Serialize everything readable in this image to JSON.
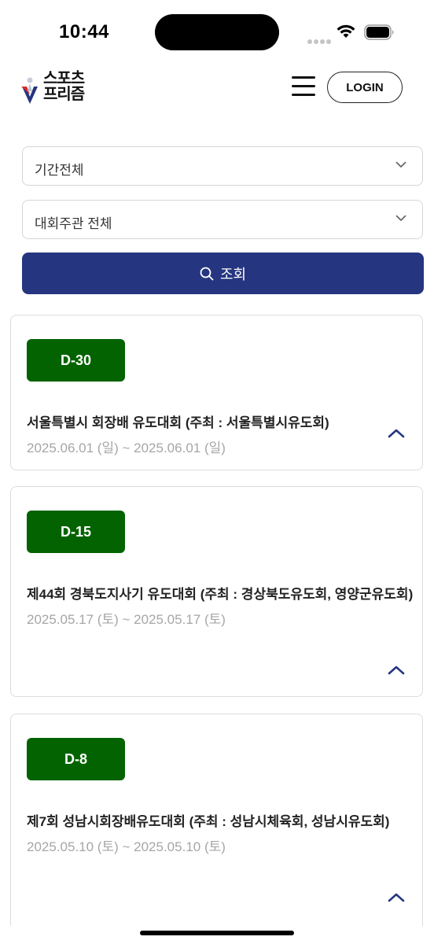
{
  "status": {
    "time": "10:44"
  },
  "header": {
    "logo_line1": "스포츠",
    "logo_line2": "프리즘",
    "login_label": "LOGIN"
  },
  "filters": {
    "period": "기간전체",
    "host": "대회주관 전체",
    "search_label": "조회"
  },
  "events": [
    {
      "dday": "D-30",
      "title": "서울특별시 회장배 유도대회 (주최 : 서울특별시유도회)",
      "date": "2025.06.01 (일) ~ 2025.06.01 (일)"
    },
    {
      "dday": "D-15",
      "title": "제44회 경북도지사기 유도대회 (주최 : 경상북도유도회, 영양군유도회)",
      "date": "2025.05.17 (토) ~ 2025.05.17 (토)"
    },
    {
      "dday": "D-8",
      "title": "제7회 성남시회장배유도대회 (주최 : 성남시체육회, 성남시유도회)",
      "date": "2025.05.10 (토) ~ 2025.05.10 (토)"
    }
  ],
  "colors": {
    "primary": "#253580",
    "badge": "#036300",
    "date_text": "#a6a6a6"
  }
}
